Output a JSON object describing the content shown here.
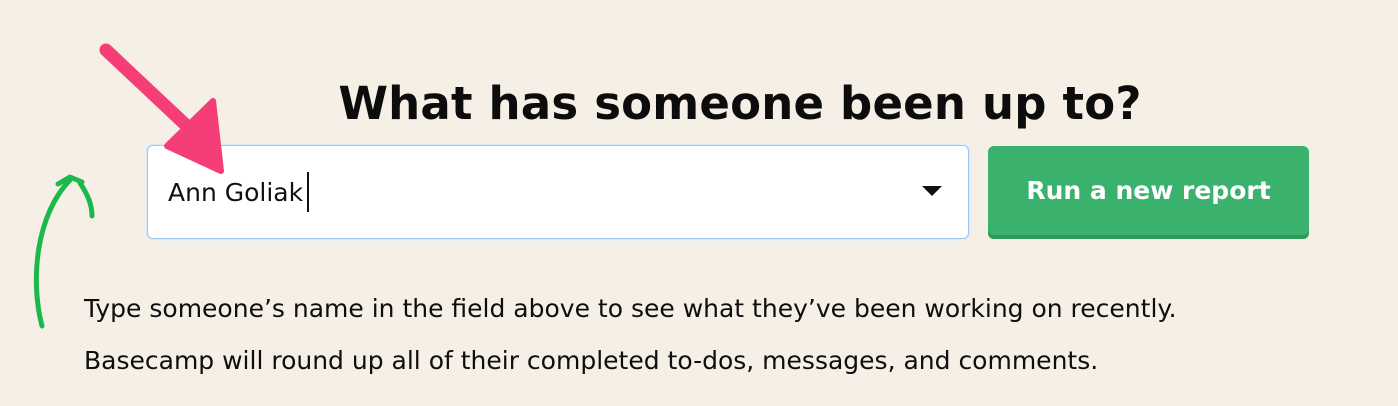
{
  "page": {
    "title": "What has someone been up to?"
  },
  "person_picker": {
    "value": "Ann Goliak",
    "dropdown_icon": "caret-down-icon"
  },
  "actions": {
    "run_report_label": "Run a new report"
  },
  "help": {
    "line1": "Type someone’s name in the field above to see what they’ve been working on recently.",
    "line2": "Basecamp will round up all of their completed to-dos, messages, and comments."
  },
  "annotations": {
    "pointer_arrow": "pink-arrow-icon",
    "pointer_arrow_color": "#f53d77",
    "curved_arrow": "green-curved-arrow-icon",
    "curved_arrow_color": "#1db84c"
  },
  "colors": {
    "background": "#f5efe5",
    "primary_button": "#3ab26d",
    "field_focus_border": "#9ec9ee"
  }
}
